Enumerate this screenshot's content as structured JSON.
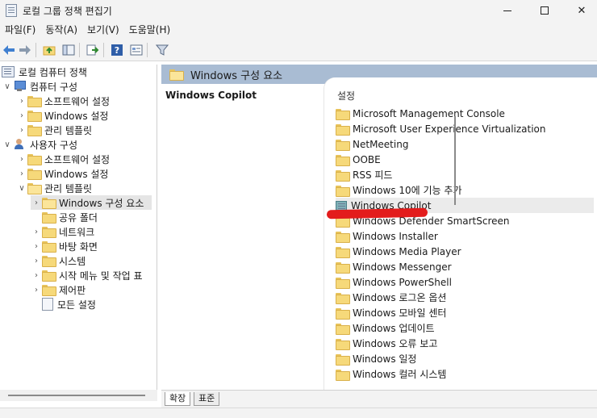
{
  "window": {
    "title": "로컬 그룹 정책 편집기"
  },
  "menu": [
    "파일(F)",
    "동작(A)",
    "보기(V)",
    "도움말(H)"
  ],
  "tree": {
    "root": "로컬 컴퓨터 정책",
    "computer": "컴퓨터 구성",
    "computer_children": [
      "소프트웨어 설정",
      "Windows 설정",
      "관리 템플릿"
    ],
    "user": "사용자 구성",
    "user_children": [
      "소프트웨어 설정",
      "Windows 설정",
      "관리 템플릿"
    ],
    "admin_children": [
      "Windows 구성 요소",
      "공유 폴더",
      "네트워크",
      "바탕 화면",
      "시스템",
      "시작 메뉴 및 작업 표",
      "제어판",
      "모든 설정"
    ]
  },
  "right": {
    "header": "Windows 구성 요소",
    "selected_title": "Windows Copilot",
    "list_header": "설정",
    "items": [
      "Microsoft Management Console",
      "Microsoft User Experience Virtualization",
      "NetMeeting",
      "OOBE",
      "RSS 피드",
      "Windows 10에 기능 추가",
      "Windows Copilot",
      "Windows Defender SmartScreen",
      "Windows Installer",
      "Windows Media Player",
      "Windows Messenger",
      "Windows PowerShell",
      "Windows 로그온 옵션",
      "Windows 모바일 센터",
      "Windows 업데이트",
      "Windows 오류 보고",
      "Windows 일정",
      "Windows 컬러 시스템"
    ]
  },
  "tabs": [
    "확장",
    "표준"
  ]
}
